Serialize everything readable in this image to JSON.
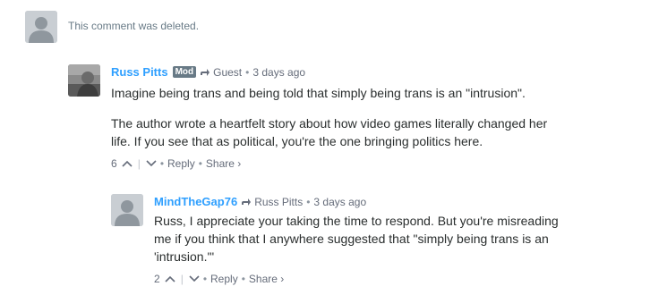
{
  "deleted_comment": {
    "text": "This comment was deleted."
  },
  "comment1": {
    "author": "Russ Pitts",
    "badge": "Mod",
    "reply_to": "Guest",
    "time": "3 days ago",
    "paragraph1": "Imagine being trans and being told that simply being trans is an \"intrusion\".",
    "paragraph2_line1": "The author wrote a heartfelt story about how video games literally changed her",
    "paragraph2_line2": "life. If you see that as political, you're the one bringing politics here.",
    "upvotes": "6",
    "reply_label": "Reply",
    "share_label": "Share ›"
  },
  "comment2": {
    "author": "MindTheGap76",
    "reply_to": "Russ Pitts",
    "time": "3 days ago",
    "line1": "Russ, I appreciate your taking the time to respond. But you're misreading",
    "line2": "me if you think that I anywhere suggested that \"simply being trans is an",
    "line3": "'intrusion.'\"",
    "upvotes": "2",
    "reply_label": "Reply",
    "share_label": "Share ›"
  },
  "colors": {
    "author_link": "#2e9fff",
    "meta_gray": "#656c7a",
    "badge_bg": "#687a86"
  }
}
